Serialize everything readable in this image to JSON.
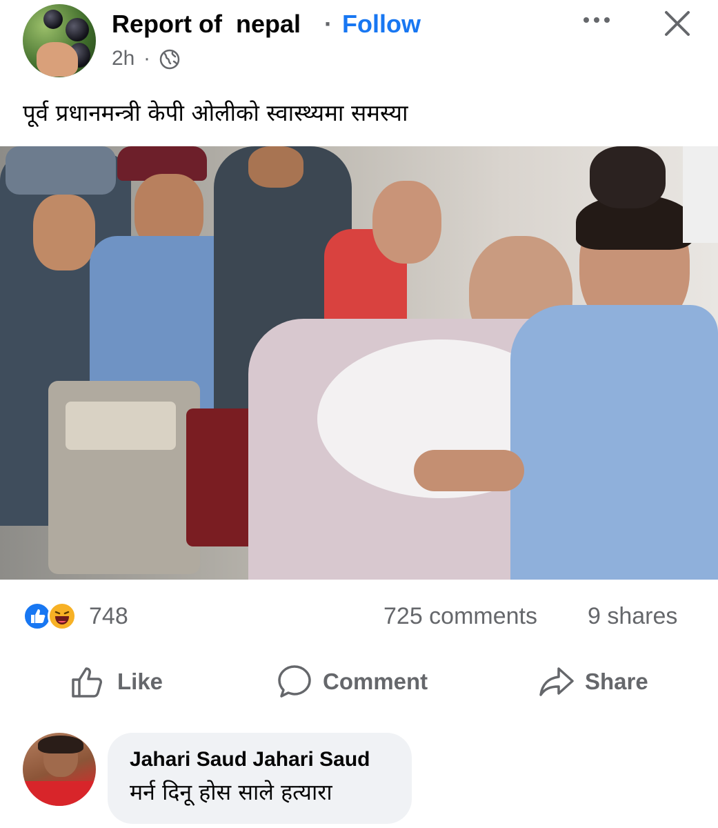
{
  "post": {
    "page_name": "Report of  nepal",
    "separator": "·",
    "follow_label": "Follow",
    "timestamp": "2h",
    "timestamp_separator": "·",
    "privacy_icon": "globe-icon",
    "more_icon": "more-icon",
    "close_icon": "close-icon",
    "caption": "पूर्व प्रधानमन्त्री केपी ओलीको स्वास्थ्यमा समस्या"
  },
  "stats": {
    "reaction_icons": [
      "like-icon",
      "haha-icon"
    ],
    "reaction_count": "748",
    "comments": "725 comments",
    "shares": "9 shares"
  },
  "actions": {
    "like_label": "Like",
    "comment_label": "Comment",
    "share_label": "Share"
  },
  "comment": {
    "author": "Jahari Saud Jahari Saud",
    "text": "मर्न दिनू होस साले हत्यारा"
  },
  "colors": {
    "brand_blue": "#1877f2",
    "secondary_text": "#65676b",
    "comment_bubble": "#f0f2f5",
    "haha_yellow": "#f7b125"
  }
}
